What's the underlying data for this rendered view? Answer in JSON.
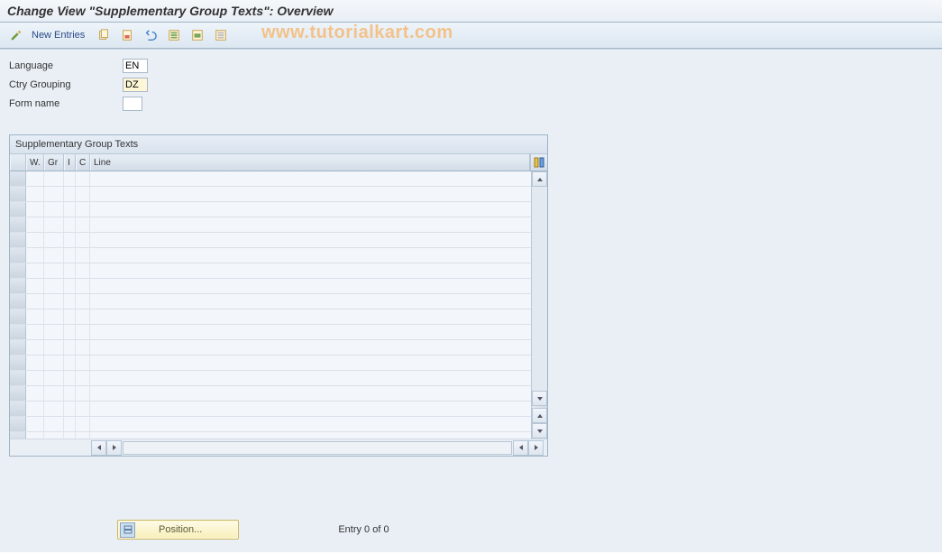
{
  "title": "Change View \"Supplementary Group Texts\": Overview",
  "watermark": "www.tutorialkart.com",
  "toolbar": {
    "new_entries": "New Entries"
  },
  "form": {
    "language_label": "Language",
    "language_value": "EN",
    "ctry_label": "Ctry Grouping",
    "ctry_value": "DZ",
    "formname_label": "Form name",
    "formname_value": ""
  },
  "panel": {
    "title": "Supplementary Group Texts",
    "columns": {
      "w": "W.",
      "gr": "Gr",
      "i": "I",
      "c": "C",
      "line": "Line"
    },
    "rows": [
      {},
      {},
      {},
      {},
      {},
      {},
      {},
      {},
      {},
      {},
      {},
      {},
      {},
      {},
      {},
      {},
      {},
      {}
    ]
  },
  "footer": {
    "position_label": "Position...",
    "entry_text": "Entry 0 of 0"
  }
}
